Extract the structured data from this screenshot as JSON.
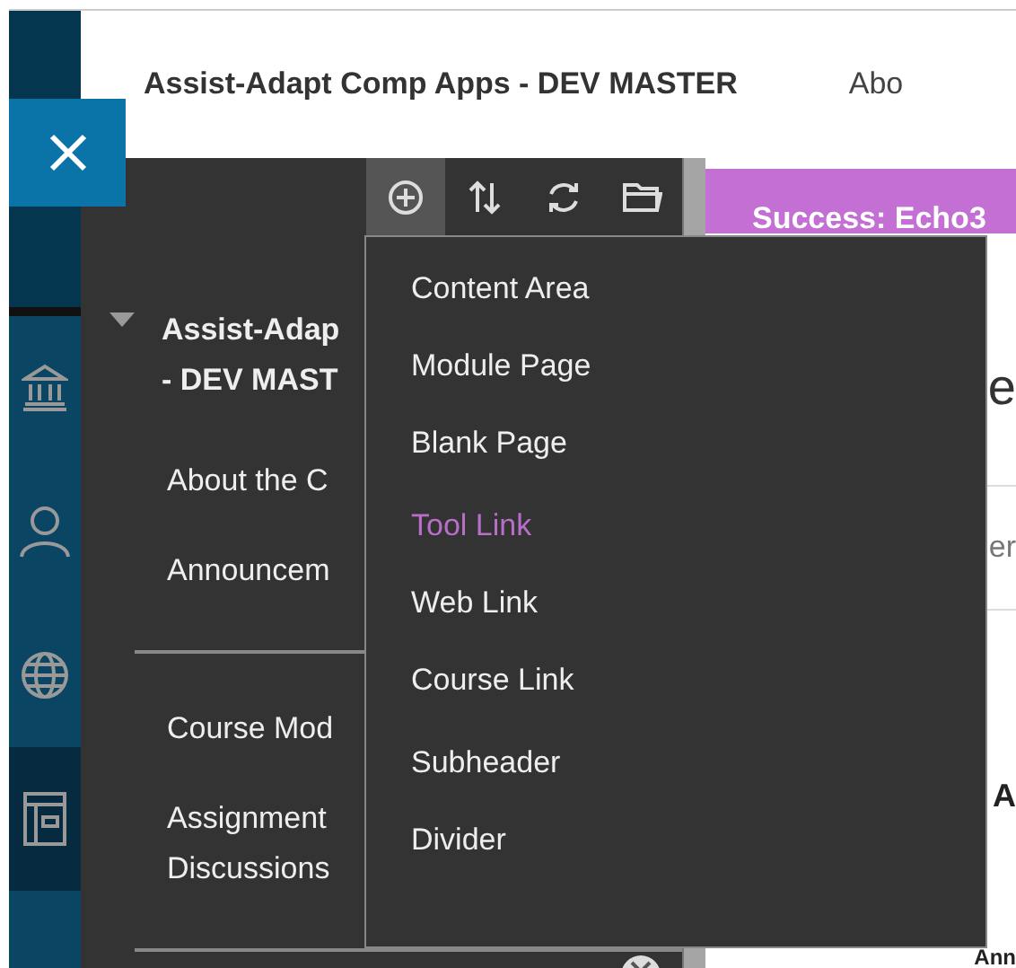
{
  "header": {
    "title": "Assist-Adapt Comp Apps - DEV MASTER",
    "nav_link": "Abo"
  },
  "rail": {
    "items": [
      {
        "kind": "bank",
        "selected": false
      },
      {
        "kind": "person",
        "selected": false
      },
      {
        "kind": "globe",
        "selected": false
      },
      {
        "kind": "layout",
        "selected": true
      }
    ]
  },
  "toolbar": {
    "buttons": [
      {
        "kind": "add",
        "selected": true
      },
      {
        "kind": "sort",
        "selected": false
      },
      {
        "kind": "refresh",
        "selected": false
      },
      {
        "kind": "folder",
        "selected": false
      }
    ]
  },
  "course_menu": {
    "title_lines": [
      "Assist-Adap",
      "- DEV MAST"
    ],
    "expanded": true,
    "sections": [
      [
        {
          "lines": [
            "About the C"
          ]
        },
        {
          "lines": [
            "Announcem"
          ]
        }
      ],
      [
        {
          "lines": [
            "Course Mod"
          ]
        },
        {
          "lines": [
            "Assignment",
            "Discussions"
          ]
        }
      ]
    ]
  },
  "banner": {
    "text": "Success: Echo3"
  },
  "content_fragments": [
    {
      "kind": "heading",
      "text": "e"
    },
    {
      "kind": "muted",
      "text": "er"
    },
    {
      "kind": "bold",
      "text": "A"
    },
    {
      "kind": "small",
      "text": "Ann"
    }
  ],
  "add_menu": {
    "groups": [
      [
        {
          "label": "Content Area",
          "selected": false
        },
        {
          "label": "Module Page",
          "selected": false
        },
        {
          "label": "Blank Page",
          "selected": false
        }
      ],
      [
        {
          "label": "Tool Link",
          "selected": true
        },
        {
          "label": "Web Link",
          "selected": false
        },
        {
          "label": "Course Link",
          "selected": false
        }
      ],
      [
        {
          "label": "Subheader",
          "selected": false
        },
        {
          "label": "Divider",
          "selected": false
        }
      ]
    ]
  }
}
